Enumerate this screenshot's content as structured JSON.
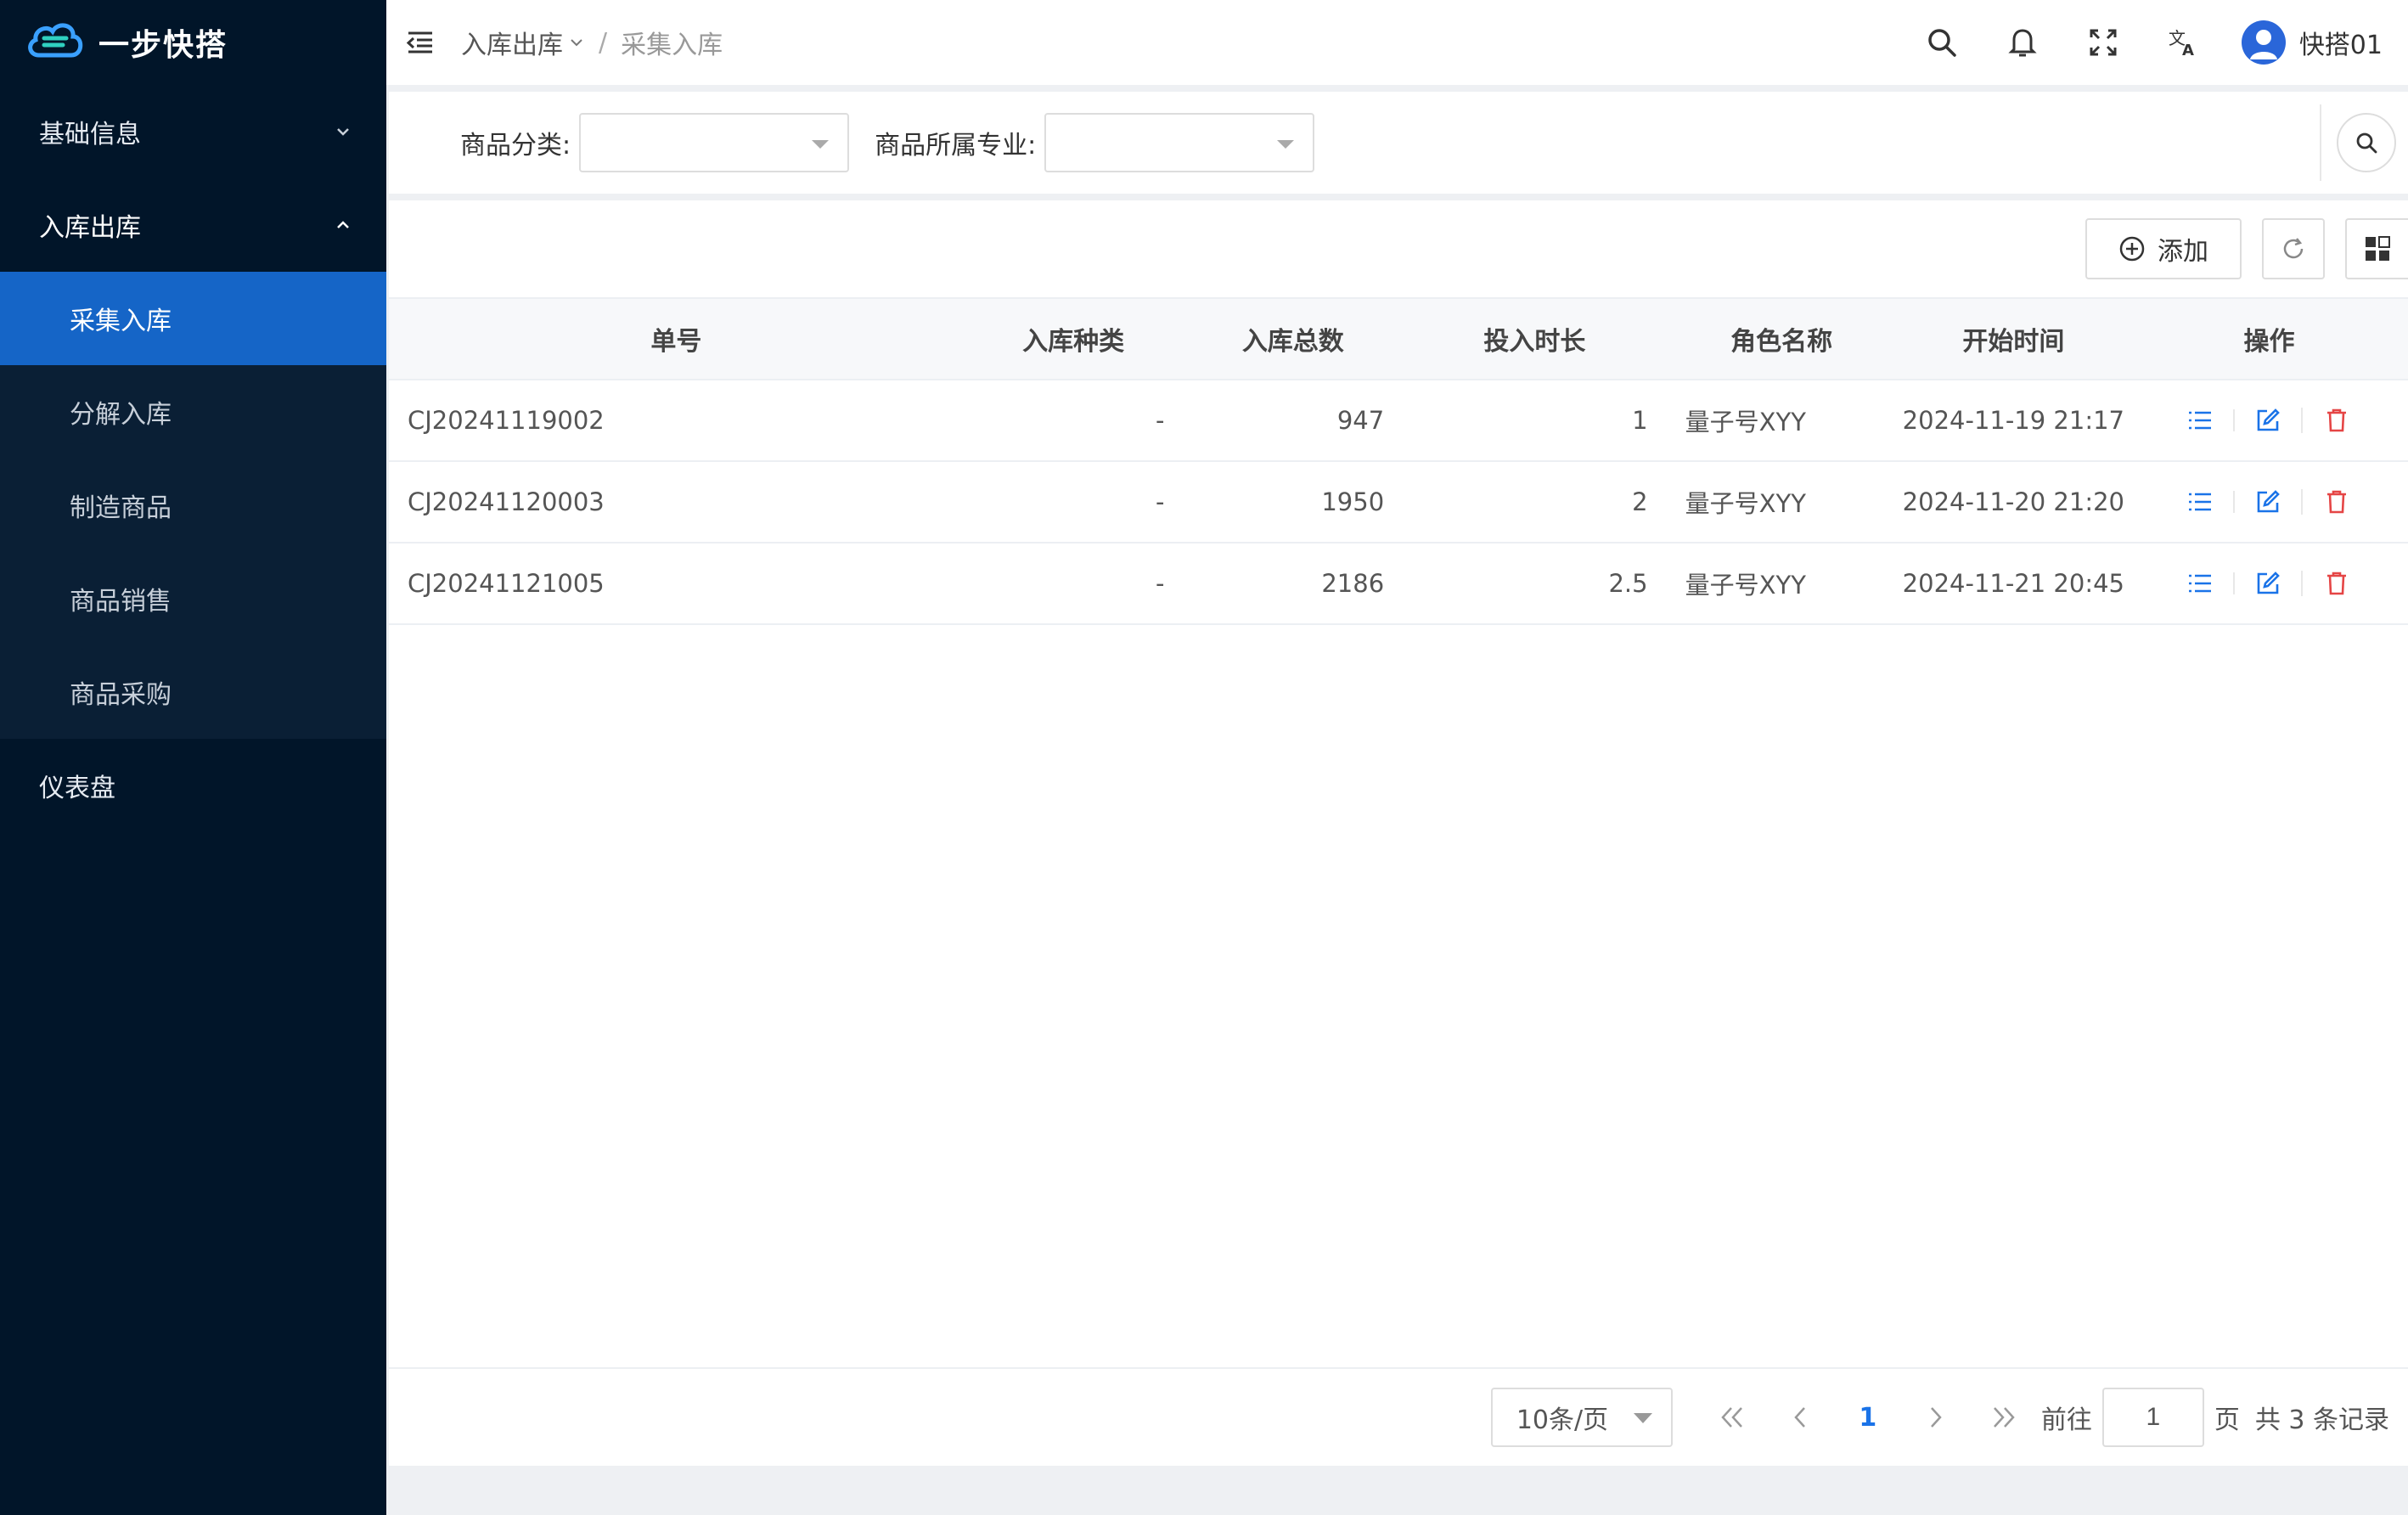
{
  "app": {
    "name": "一步快搭"
  },
  "sidebar": {
    "items": [
      {
        "label": "基础信息"
      },
      {
        "label": "入库出库"
      },
      {
        "label": "仪表盘"
      }
    ],
    "sub_items": [
      {
        "label": "采集入库"
      },
      {
        "label": "分解入库"
      },
      {
        "label": "制造商品"
      },
      {
        "label": "商品销售"
      },
      {
        "label": "商品采购"
      }
    ]
  },
  "header": {
    "breadcrumb_parent": "入库出库",
    "breadcrumb_sep": "/",
    "breadcrumb_current": "采集入库",
    "user_name": "快搭01"
  },
  "filters": {
    "category_label": "商品分类:",
    "major_label": "商品所属专业:"
  },
  "toolbar": {
    "add_label": "添加"
  },
  "table": {
    "headers": [
      "单号",
      "入库种类",
      "入库总数",
      "投入时长",
      "角色名称",
      "开始时间",
      "操作"
    ],
    "rows": [
      {
        "id": "CJ20241119002",
        "type": "-",
        "total": "947",
        "duration": "1",
        "role": "量子号XYY",
        "start": "2024-11-19 21:17"
      },
      {
        "id": "CJ20241120003",
        "type": "-",
        "total": "1950",
        "duration": "2",
        "role": "量子号XYY",
        "start": "2024-11-20 21:20"
      },
      {
        "id": "CJ20241121005",
        "type": "-",
        "total": "2186",
        "duration": "2.5",
        "role": "量子号XYY",
        "start": "2024-11-21 20:45"
      }
    ]
  },
  "pagination": {
    "page_size": "10条/页",
    "current_page": "1",
    "goto_label": "前往",
    "goto_value": "1",
    "page_unit": "页",
    "total_text": "共 3 条记录"
  },
  "colors": {
    "sidebar_bg": "#011529",
    "active": "#1565c7",
    "primary": "#1a73e8",
    "danger": "#e54545"
  }
}
